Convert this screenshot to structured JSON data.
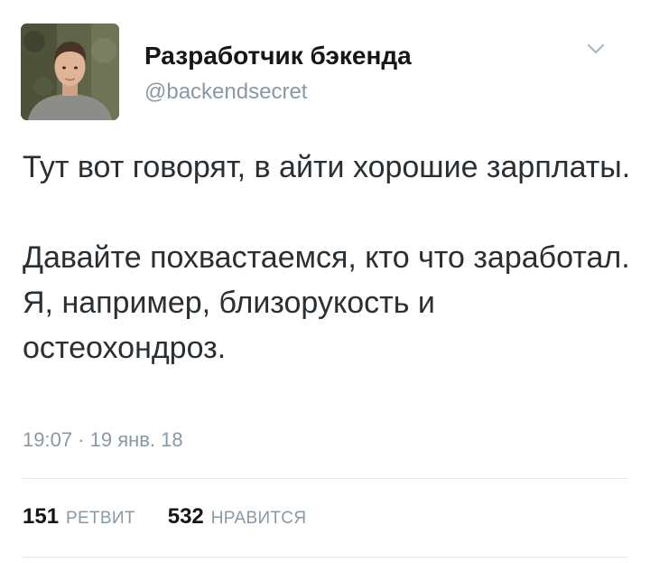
{
  "tweet": {
    "author": {
      "display_name": "Разработчик бэкенда",
      "handle": "@backendsecret",
      "avatar_icon": "profile-photo"
    },
    "menu_icon": "chevron-down-icon",
    "text_paragraphs": [
      "Тут вот говорят, в айти хорошие зарплаты.",
      "Давайте похвастаемся, кто что заработал. Я, например, близорукость и остеохондроз."
    ],
    "timestamp": "19:07 · 19 янв. 18",
    "stats": {
      "retweets": {
        "count": "151",
        "label": "РЕТВИТ"
      },
      "likes": {
        "count": "532",
        "label": "НРАВИТСЯ"
      }
    }
  },
  "colors": {
    "text_primary": "#14171a",
    "text_secondary": "#8899a6",
    "divider": "#e1e8ed",
    "background": "#ffffff"
  }
}
